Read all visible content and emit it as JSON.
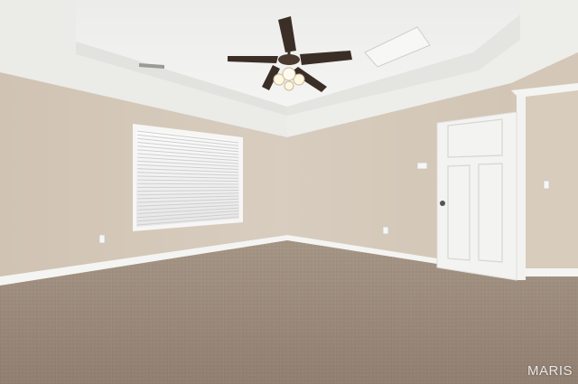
{
  "scene": {
    "description_colors": {
      "wall": "#d3c6b6",
      "ceiling": "#f1f1ef",
      "carpet": "#9c8c7e",
      "trim": "#f4f4f2",
      "door": "#f3f3f1",
      "fan_blade": "#3b2e27"
    },
    "icons": [
      "ceiling-fan-icon",
      "window-blinds-icon",
      "door-icon",
      "thermostat-icon",
      "outlet-icon",
      "light-switch-icon"
    ]
  },
  "watermark": {
    "text": "MARIS"
  }
}
